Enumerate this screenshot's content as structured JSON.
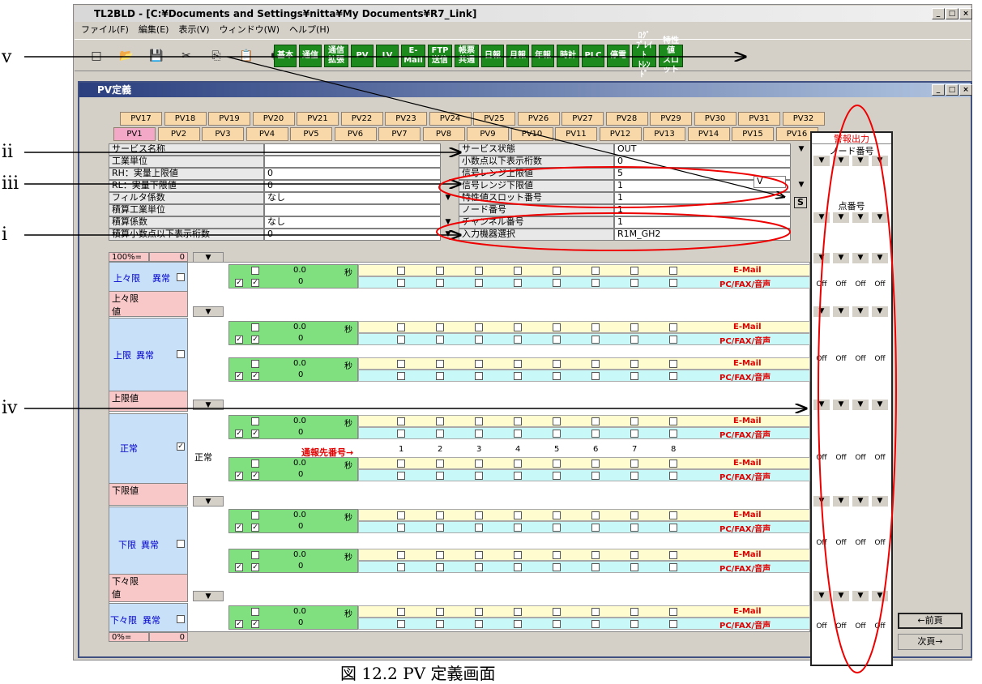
{
  "app": {
    "title": "TL2BLD - [C:¥Documents and Settings¥nitta¥My Documents¥R7_Link]",
    "icon_text": "TL2 BLD"
  },
  "menu": [
    "ファイル(F)",
    "編集(E)",
    "表示(V)",
    "ウィンドウ(W)",
    "ヘルプ(H)"
  ],
  "toolbar": {
    "buttons": [
      "基本",
      "通信",
      "通信\n拡張",
      "PV",
      "LV",
      "E-\nMail",
      "FTP\n送信",
      "帳票\n共通",
      "日報",
      "月報",
      "年報",
      "時計",
      "PLC",
      "停電",
      "ﾛｸﾞﾌﾟﾚｲﾄ\nﾄﾚﾝﾄﾞ",
      "特性値\nスロット"
    ]
  },
  "subwindow": {
    "title": "PV定義"
  },
  "tabs_row1": [
    "PV17",
    "PV18",
    "PV19",
    "PV20",
    "PV21",
    "PV22",
    "PV23",
    "PV24",
    "PV25",
    "PV26",
    "PV27",
    "PV28",
    "PV29",
    "PV30",
    "PV31",
    "PV32"
  ],
  "tabs_row2": [
    "PV1",
    "PV2",
    "PV3",
    "PV4",
    "PV5",
    "PV6",
    "PV7",
    "PV8",
    "PV9",
    "PV10",
    "PV11",
    "PV12",
    "PV13",
    "PV14",
    "PV15",
    "PV16"
  ],
  "form_left": [
    {
      "label": "サービス名称",
      "value": ""
    },
    {
      "label": "工業単位",
      "value": ""
    },
    {
      "label": "RH：実量上限値",
      "value": "0"
    },
    {
      "label": "RL：実量下限値",
      "value": "0"
    },
    {
      "label": "フィルタ係数",
      "value": "なし"
    },
    {
      "label": "積算工業単位",
      "value": ""
    },
    {
      "label": "積算係数",
      "value": "なし"
    },
    {
      "label": "積算小数点以下表示桁数",
      "value": "0"
    }
  ],
  "form_right": [
    {
      "label": "サービス状態",
      "value": "OUT"
    },
    {
      "label": "小数点以下表示桁数",
      "value": "0"
    },
    {
      "label": "信号レンジ上限値",
      "value": "5"
    },
    {
      "label": "信号レンジ下限値",
      "value": "1"
    },
    {
      "label": "特性値スロット番号",
      "value": "1"
    },
    {
      "label": "ノード番号",
      "value": "1"
    },
    {
      "label": "チャンネル番号",
      "value": "1"
    },
    {
      "label": "入力機器選択",
      "value": "R1M_GH2"
    }
  ],
  "range_unit": "V",
  "s_button": "S",
  "alarm_header": {
    "title": "警報出力",
    "node": "ノード番号",
    "point": "点番号"
  },
  "percent_top": "100%=",
  "percent_top_val": "0",
  "percent_bottom": "0%=",
  "percent_bottom_val": "0",
  "levels": {
    "hh": "上々限",
    "hh_abnormal": "異常",
    "hh_value": "上々限\n値",
    "h": "上限",
    "h_abnormal": "異常",
    "h_value": "上限値",
    "normal": "正常",
    "normal2": "正常",
    "l_value": "下限値",
    "l": "下限",
    "l_abnormal": "異常",
    "ll_value": "下々限\n値",
    "ll": "下々限",
    "ll_abnormal": "異常"
  },
  "row": {
    "val1": "0.0",
    "val2": "0",
    "unit": "秒",
    "email": "E-Mail",
    "pcfax": "PC/FAX/音声"
  },
  "notify": {
    "label": "通報先番号→",
    "nums": [
      "1",
      "2",
      "3",
      "4",
      "5",
      "6",
      "7",
      "8"
    ]
  },
  "off_label": "Off",
  "nav": {
    "prev": "←前頁",
    "next": "次頁→"
  },
  "annotations": [
    "v",
    "ii",
    "iii",
    "i",
    "iv"
  ],
  "caption": "図 12.2 PV 定義画面"
}
